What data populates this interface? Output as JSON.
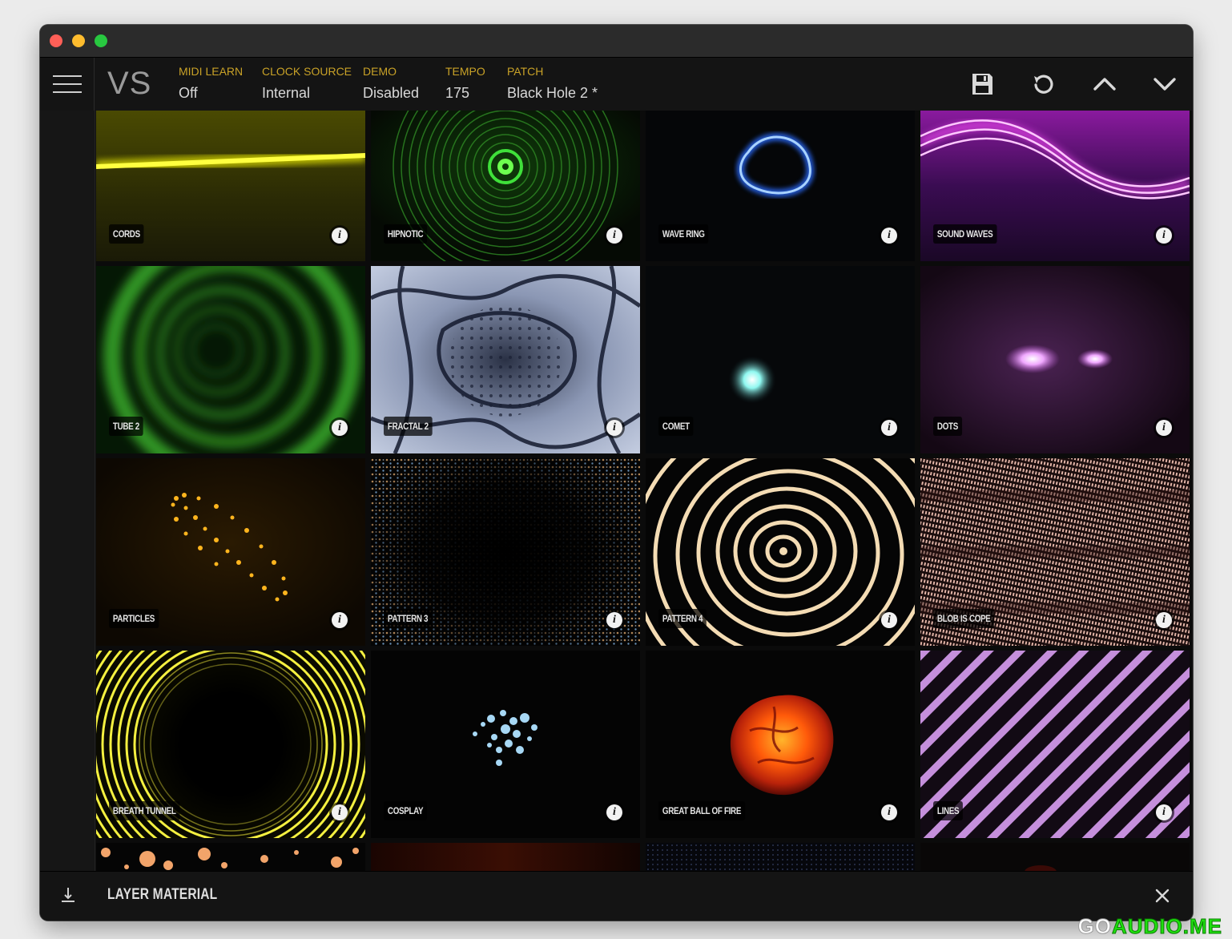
{
  "toolbar": {
    "logo": "VS",
    "fields": [
      {
        "label": "MIDI LEARN",
        "value": "Off"
      },
      {
        "label": "CLOCK SOURCE",
        "value": "Internal"
      },
      {
        "label": "DEMO",
        "value": "Disabled"
      },
      {
        "label": "TEMPO",
        "value": "175"
      },
      {
        "label": "PATCH",
        "value": "Black Hole 2 *"
      }
    ],
    "icons": [
      "save-icon",
      "reset-icon",
      "chevron-up-icon",
      "chevron-down-icon"
    ]
  },
  "tiles": [
    {
      "name": "CORDS"
    },
    {
      "name": "HIPNOTIC"
    },
    {
      "name": "WAVE RING"
    },
    {
      "name": "SOUND WAVES"
    },
    {
      "name": "TUBE 2"
    },
    {
      "name": "FRACTAL 2"
    },
    {
      "name": "COMET"
    },
    {
      "name": "DOTS"
    },
    {
      "name": "PARTICLES"
    },
    {
      "name": "PATTERN 3"
    },
    {
      "name": "PATTERN 4"
    },
    {
      "name": "BLOB IS COPE"
    },
    {
      "name": "BREATH TUNNEL"
    },
    {
      "name": "COSPLAY"
    },
    {
      "name": "GREAT BALL OF FIRE"
    },
    {
      "name": "LINES"
    }
  ],
  "info_glyph": "i",
  "bottom": {
    "title": "LAYER MATERIAL"
  },
  "watermark": {
    "part1": "GO",
    "part2": "AUDIO.ME"
  },
  "colors": {
    "accent_label": "#c9a227",
    "background": "#111111"
  }
}
